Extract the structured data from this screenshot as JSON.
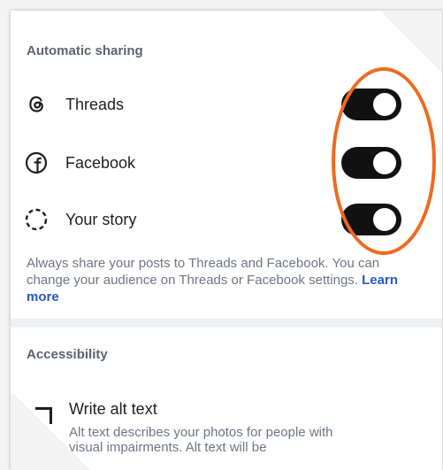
{
  "automatic_sharing": {
    "title": "Automatic sharing",
    "items": [
      {
        "label": "Threads",
        "enabled": true
      },
      {
        "label": "Facebook",
        "enabled": true
      },
      {
        "label": "Your story",
        "enabled": true
      }
    ],
    "description": "Always share your posts to Threads and Facebook. You can change your audience on Threads or Facebook settings.",
    "learn_more": "Learn more"
  },
  "accessibility": {
    "title": "Accessibility",
    "alt_text_title": "Write alt text",
    "alt_text_desc": "Alt text describes your photos for people with visual impairments. Alt text will be"
  },
  "colors": {
    "toggle_on": "#111111",
    "link": "#2b55c8",
    "highlight": "#f06a1d"
  }
}
